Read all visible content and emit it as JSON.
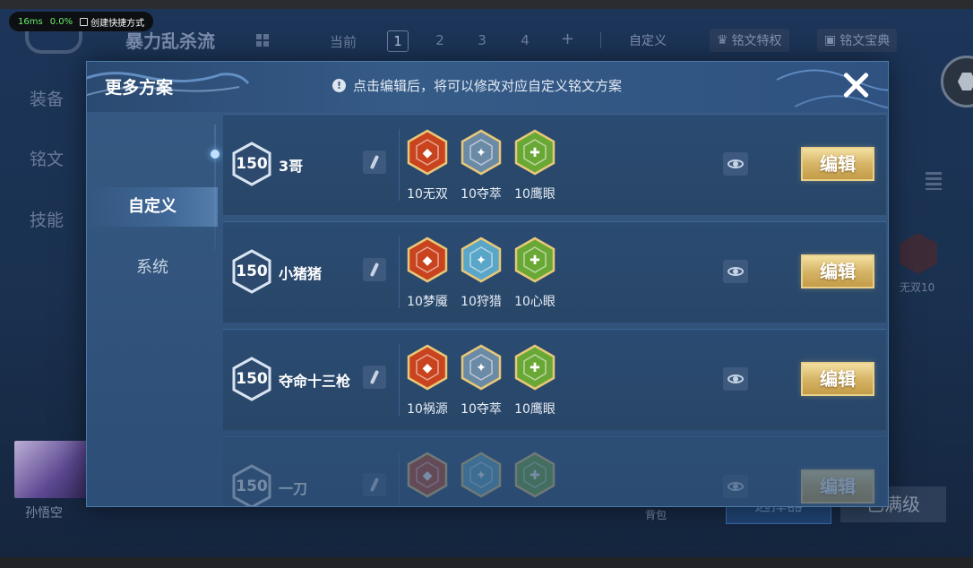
{
  "perf": {
    "latency": "16ms",
    "cpu": "0.0%",
    "shortcut": "创建快捷方式"
  },
  "background": {
    "title": "暴力乱杀流",
    "current_label": "当前",
    "pages": [
      "1",
      "2",
      "3",
      "4"
    ],
    "add": "+",
    "custom": "自定义",
    "rune_privilege": "铭文特权",
    "rune_treasure": "铭文宝典",
    "side": [
      "装备",
      "铭文",
      "技能"
    ],
    "hero_name": "孙悟空",
    "bag": "背包",
    "btn_select": "选择器",
    "btn_maxed": "已满级",
    "right_rune_label": "无双10"
  },
  "modal": {
    "title": "更多方案",
    "notice": "点击编辑后，将可以修改对应自定义铭文方案",
    "info_icon": "!",
    "nav": [
      {
        "label": "自定义",
        "active": true
      },
      {
        "label": "系统",
        "active": false
      }
    ],
    "edit_label": "编辑",
    "plans": [
      {
        "level": "150",
        "name": "3哥",
        "runes": [
          {
            "label": "10无双",
            "color": "#c8431e"
          },
          {
            "label": "10夺萃",
            "color": "#6b8aa6"
          },
          {
            "label": "10鹰眼",
            "color": "#6aa836"
          }
        ]
      },
      {
        "level": "150",
        "name": "小猪猪",
        "runes": [
          {
            "label": "10梦魇",
            "color": "#c8431e"
          },
          {
            "label": "10狩猎",
            "color": "#5aa6c8"
          },
          {
            "label": "10心眼",
            "color": "#6aa836"
          }
        ]
      },
      {
        "level": "150",
        "name": "夺命十三枪",
        "runes": [
          {
            "label": "10祸源",
            "color": "#c8431e"
          },
          {
            "label": "10夺萃",
            "color": "#6b8aa6"
          },
          {
            "label": "10鹰眼",
            "color": "#6aa836"
          }
        ]
      },
      {
        "level": "150",
        "name": "一刀",
        "runes": [
          {
            "label": "",
            "color": "#c8431e"
          },
          {
            "label": "",
            "color": "#5aa6c8"
          },
          {
            "label": "",
            "color": "#6aa836"
          }
        ]
      }
    ]
  }
}
